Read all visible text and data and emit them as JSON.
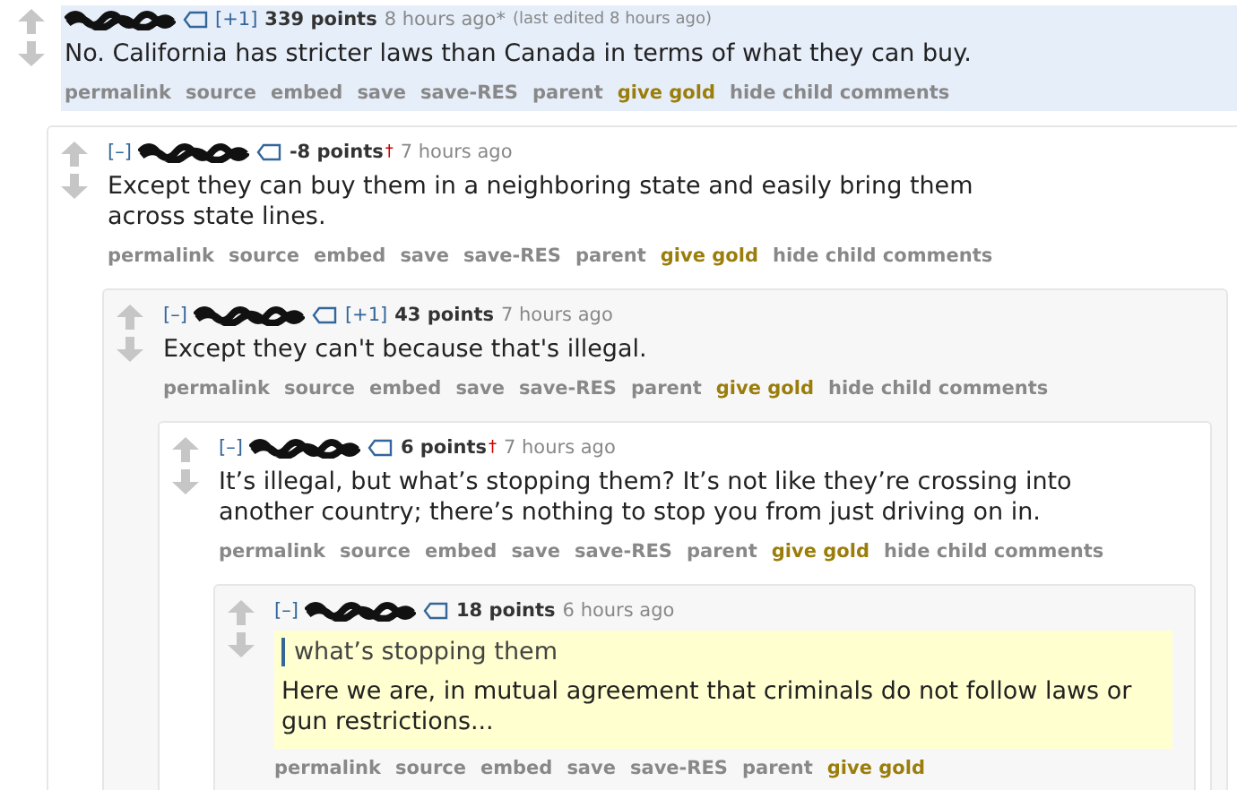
{
  "comments": [
    {
      "vote_delta": "[+1]",
      "score": "339 points",
      "time": "8 hours ago",
      "edited_mark": "*",
      "edited_note": "(last edited 8 hours ago)",
      "highlighted": true,
      "body_highlighted": false,
      "body": [
        {
          "kind": "paragraph",
          "text": "No. California has stricter laws than Canada in terms of what they can buy."
        }
      ],
      "actions": [
        "permalink",
        "source",
        "embed",
        "save",
        "save-RES",
        "parent",
        "give gold",
        "hide child comments"
      ],
      "children": [
        {
          "collapse": "[–]",
          "score": "-8 points",
          "dagger": "†",
          "time": "7 hours ago",
          "highlighted": false,
          "body_highlighted": false,
          "body": [
            {
              "kind": "paragraph",
              "text": "Except they can buy them in a neighboring state and easily bring them across state lines."
            }
          ],
          "actions": [
            "permalink",
            "source",
            "embed",
            "save",
            "save-RES",
            "parent",
            "give gold",
            "hide child comments"
          ],
          "children": [
            {
              "collapse": "[–]",
              "vote_delta": "[+1]",
              "score": "43 points",
              "time": "7 hours ago",
              "highlighted": false,
              "body_highlighted": false,
              "body": [
                {
                  "kind": "paragraph",
                  "text": "Except they can't because that's illegal."
                }
              ],
              "actions": [
                "permalink",
                "source",
                "embed",
                "save",
                "save-RES",
                "parent",
                "give gold",
                "hide child comments"
              ],
              "children": [
                {
                  "collapse": "[–]",
                  "score": "6 points",
                  "dagger": "†",
                  "time": "7 hours ago",
                  "highlighted": false,
                  "body_highlighted": false,
                  "body": [
                    {
                      "kind": "paragraph",
                      "text": "It’s illegal, but what’s stopping them? It’s not like they’re crossing into another country; there’s nothing to stop you from just driving on in."
                    }
                  ],
                  "actions": [
                    "permalink",
                    "source",
                    "embed",
                    "save",
                    "save-RES",
                    "parent",
                    "give gold",
                    "hide child comments"
                  ],
                  "children": [
                    {
                      "collapse": "[–]",
                      "score": "18 points",
                      "time": "6 hours ago",
                      "highlighted": false,
                      "body_highlighted": true,
                      "body": [
                        {
                          "kind": "quote",
                          "text": "what’s stopping them"
                        },
                        {
                          "kind": "paragraph",
                          "text": "Here we are, in mutual agreement that criminals do not follow laws or gun restrictions..."
                        }
                      ],
                      "actions": [
                        "permalink",
                        "source",
                        "embed",
                        "save",
                        "save-RES",
                        "parent",
                        "give gold"
                      ]
                    }
                  ]
                }
              ]
            }
          ]
        }
      ]
    }
  ]
}
